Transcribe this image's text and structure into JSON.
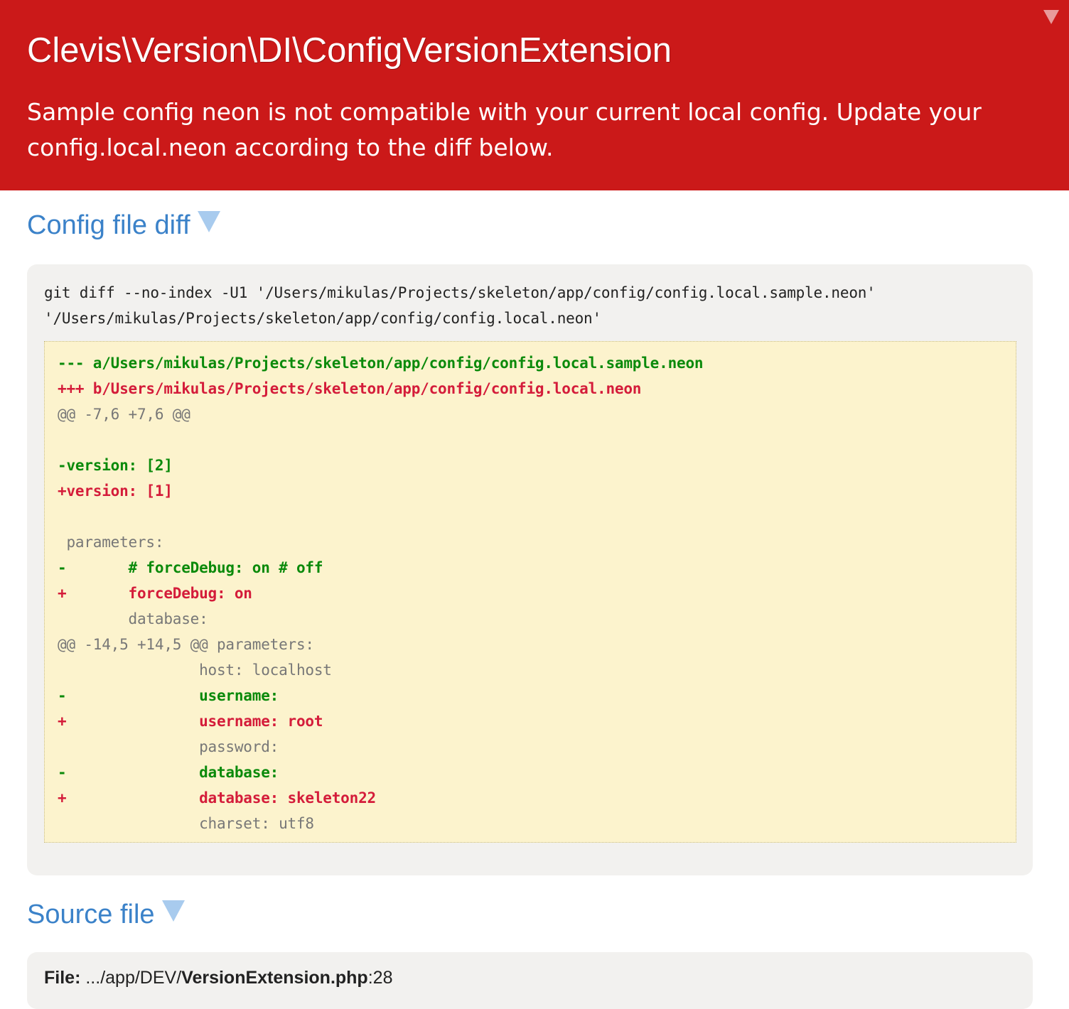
{
  "header": {
    "title": "Clevis\\Version\\DI\\ConfigVersionExtension",
    "message": "Sample config neon is not compatible with your current local config. Update your config.local.neon according to the diff below.",
    "toggle_icon": "triangle-down-icon"
  },
  "sections": {
    "diff_title": "Config file diff",
    "source_title": "Source file"
  },
  "diff": {
    "command": "git diff --no-index -U1 '/Users/mikulas/Projects/skeleton/app/config/config.local.sample.neon' '/Users/mikulas/Projects/skeleton/app/config/config.local.neon'",
    "lines": [
      {
        "kind": "del",
        "text": "--- a/Users/mikulas/Projects/skeleton/app/config/config.local.sample.neon"
      },
      {
        "kind": "add",
        "text": "+++ b/Users/mikulas/Projects/skeleton/app/config/config.local.neon"
      },
      {
        "kind": "ctx",
        "text": "@@ -7,6 +7,6 @@"
      },
      {
        "kind": "ctx",
        "text": ""
      },
      {
        "kind": "del",
        "text": "-version: [2]"
      },
      {
        "kind": "add",
        "text": "+version: [1]"
      },
      {
        "kind": "ctx",
        "text": ""
      },
      {
        "kind": "ctx",
        "text": " parameters:"
      },
      {
        "kind": "del",
        "text": "-       # forceDebug: on # off"
      },
      {
        "kind": "add",
        "text": "+       forceDebug: on"
      },
      {
        "kind": "ctx",
        "text": "        database:"
      },
      {
        "kind": "ctx",
        "text": "@@ -14,5 +14,5 @@ parameters:"
      },
      {
        "kind": "ctx",
        "text": "                host: localhost"
      },
      {
        "kind": "del",
        "text": "-               username:"
      },
      {
        "kind": "add",
        "text": "+               username: root"
      },
      {
        "kind": "ctx",
        "text": "                password:"
      },
      {
        "kind": "del",
        "text": "-               database:"
      },
      {
        "kind": "add",
        "text": "+               database: skeleton22"
      },
      {
        "kind": "ctx",
        "text": "                charset: utf8"
      }
    ]
  },
  "source": {
    "label": "File:",
    "path": ".../app/DEV/",
    "filename": "VersionExtension.php",
    "line": ":28"
  },
  "colors": {
    "header_bg": "#cb1919",
    "link": "#3b82c9",
    "diff_bg": "#fcf3cd",
    "deleted": "#0b8a0b",
    "added": "#d41c3a",
    "context": "#777777"
  }
}
